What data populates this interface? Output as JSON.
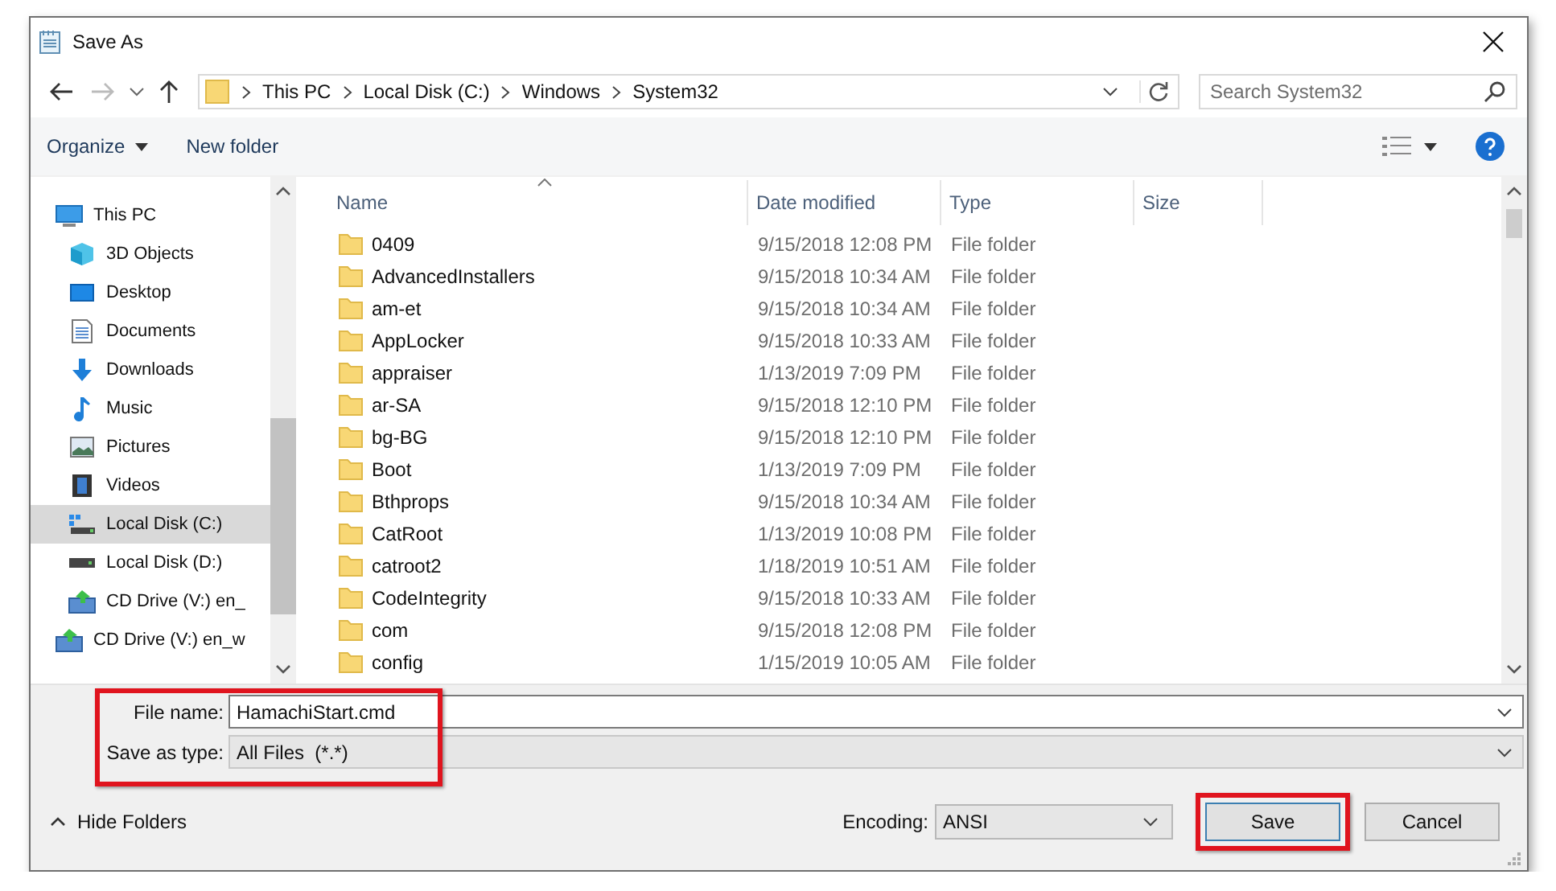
{
  "window": {
    "title": "Save As"
  },
  "navigation": {
    "back_enabled": true,
    "forward_enabled": false,
    "path": [
      "This PC",
      "Local Disk (C:)",
      "Windows",
      "System32"
    ],
    "search": {
      "placeholder": "Search System32"
    }
  },
  "toolbar": {
    "organize": "Organize",
    "new_folder": "New folder"
  },
  "sidebar": {
    "items": [
      {
        "label": "This PC",
        "kind": "pc",
        "selected": false,
        "children": [
          {
            "label": "3D Objects",
            "kind": "cube",
            "selected": false
          },
          {
            "label": "Desktop",
            "kind": "desktop",
            "selected": false
          },
          {
            "label": "Documents",
            "kind": "documents",
            "selected": false
          },
          {
            "label": "Downloads",
            "kind": "downloads",
            "selected": false
          },
          {
            "label": "Music",
            "kind": "music",
            "selected": false
          },
          {
            "label": "Pictures",
            "kind": "pictures",
            "selected": false
          },
          {
            "label": "Videos",
            "kind": "videos",
            "selected": false
          },
          {
            "label": "Local Disk (C:)",
            "kind": "system-drive",
            "selected": true
          },
          {
            "label": "Local Disk (D:)",
            "kind": "drive",
            "selected": false
          },
          {
            "label": "CD Drive (V:) en_",
            "kind": "cd",
            "selected": false
          }
        ]
      },
      {
        "label": "CD Drive (V:) en_w",
        "kind": "cd",
        "selected": false
      }
    ]
  },
  "table": {
    "columns": [
      {
        "label": "Name",
        "sorted": true
      },
      {
        "label": "Date modified",
        "sorted": false
      },
      {
        "label": "Type",
        "sorted": false
      },
      {
        "label": "Size",
        "sorted": false
      }
    ],
    "rows": [
      {
        "name": "0409",
        "date": "9/15/2018 12:08 PM",
        "type": "File folder"
      },
      {
        "name": "AdvancedInstallers",
        "date": "9/15/2018 10:34 AM",
        "type": "File folder"
      },
      {
        "name": "am-et",
        "date": "9/15/2018 10:34 AM",
        "type": "File folder"
      },
      {
        "name": "AppLocker",
        "date": "9/15/2018 10:33 AM",
        "type": "File folder"
      },
      {
        "name": "appraiser",
        "date": "1/13/2019 7:09 PM",
        "type": "File folder"
      },
      {
        "name": "ar-SA",
        "date": "9/15/2018 12:10 PM",
        "type": "File folder"
      },
      {
        "name": "bg-BG",
        "date": "9/15/2018 12:10 PM",
        "type": "File folder"
      },
      {
        "name": "Boot",
        "date": "1/13/2019 7:09 PM",
        "type": "File folder"
      },
      {
        "name": "Bthprops",
        "date": "9/15/2018 10:34 AM",
        "type": "File folder"
      },
      {
        "name": "CatRoot",
        "date": "1/13/2019 10:08 PM",
        "type": "File folder"
      },
      {
        "name": "catroot2",
        "date": "1/18/2019 10:51 AM",
        "type": "File folder"
      },
      {
        "name": "CodeIntegrity",
        "date": "9/15/2018 10:33 AM",
        "type": "File folder"
      },
      {
        "name": "com",
        "date": "9/15/2018 12:08 PM",
        "type": "File folder"
      },
      {
        "name": "config",
        "date": "1/15/2019 10:05 AM",
        "type": "File folder"
      }
    ]
  },
  "form": {
    "file_name": {
      "label": "File name:",
      "value": "HamachiStart.cmd"
    },
    "save_as_type": {
      "label": "Save as type:",
      "value": "All Files  (*.*)"
    },
    "highlighted": true
  },
  "footer": {
    "hide_folders": "Hide Folders",
    "encoding": {
      "label": "Encoding:",
      "value": "ANSI"
    },
    "buttons": [
      {
        "label": "Save",
        "kind": "primary",
        "highlighted": true
      },
      {
        "label": "Cancel",
        "kind": "secondary",
        "highlighted": false
      }
    ]
  }
}
